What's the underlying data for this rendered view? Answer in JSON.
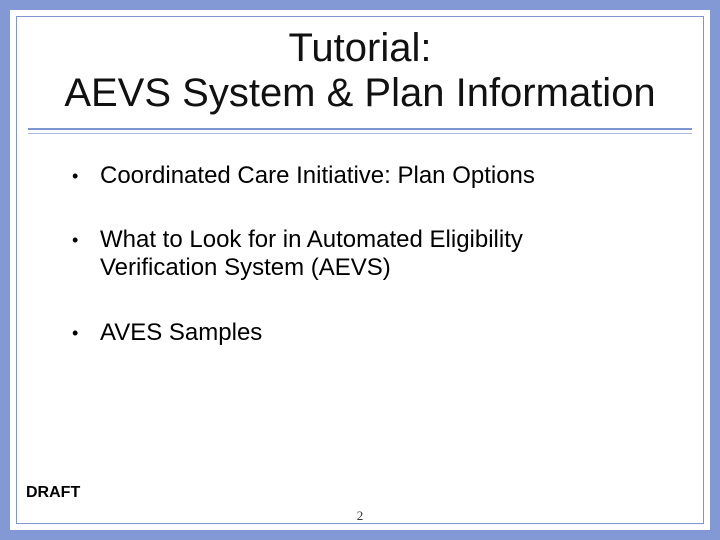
{
  "title": {
    "line1": "Tutorial:",
    "line2": "AEVS System & Plan Information"
  },
  "bullets": [
    "Coordinated Care Initiative: Plan Options",
    "What to Look for in Automated Eligibility Verification System (AEVS)",
    "AVES Samples"
  ],
  "footer": {
    "draft_label": "DRAFT",
    "page_number": "2"
  }
}
